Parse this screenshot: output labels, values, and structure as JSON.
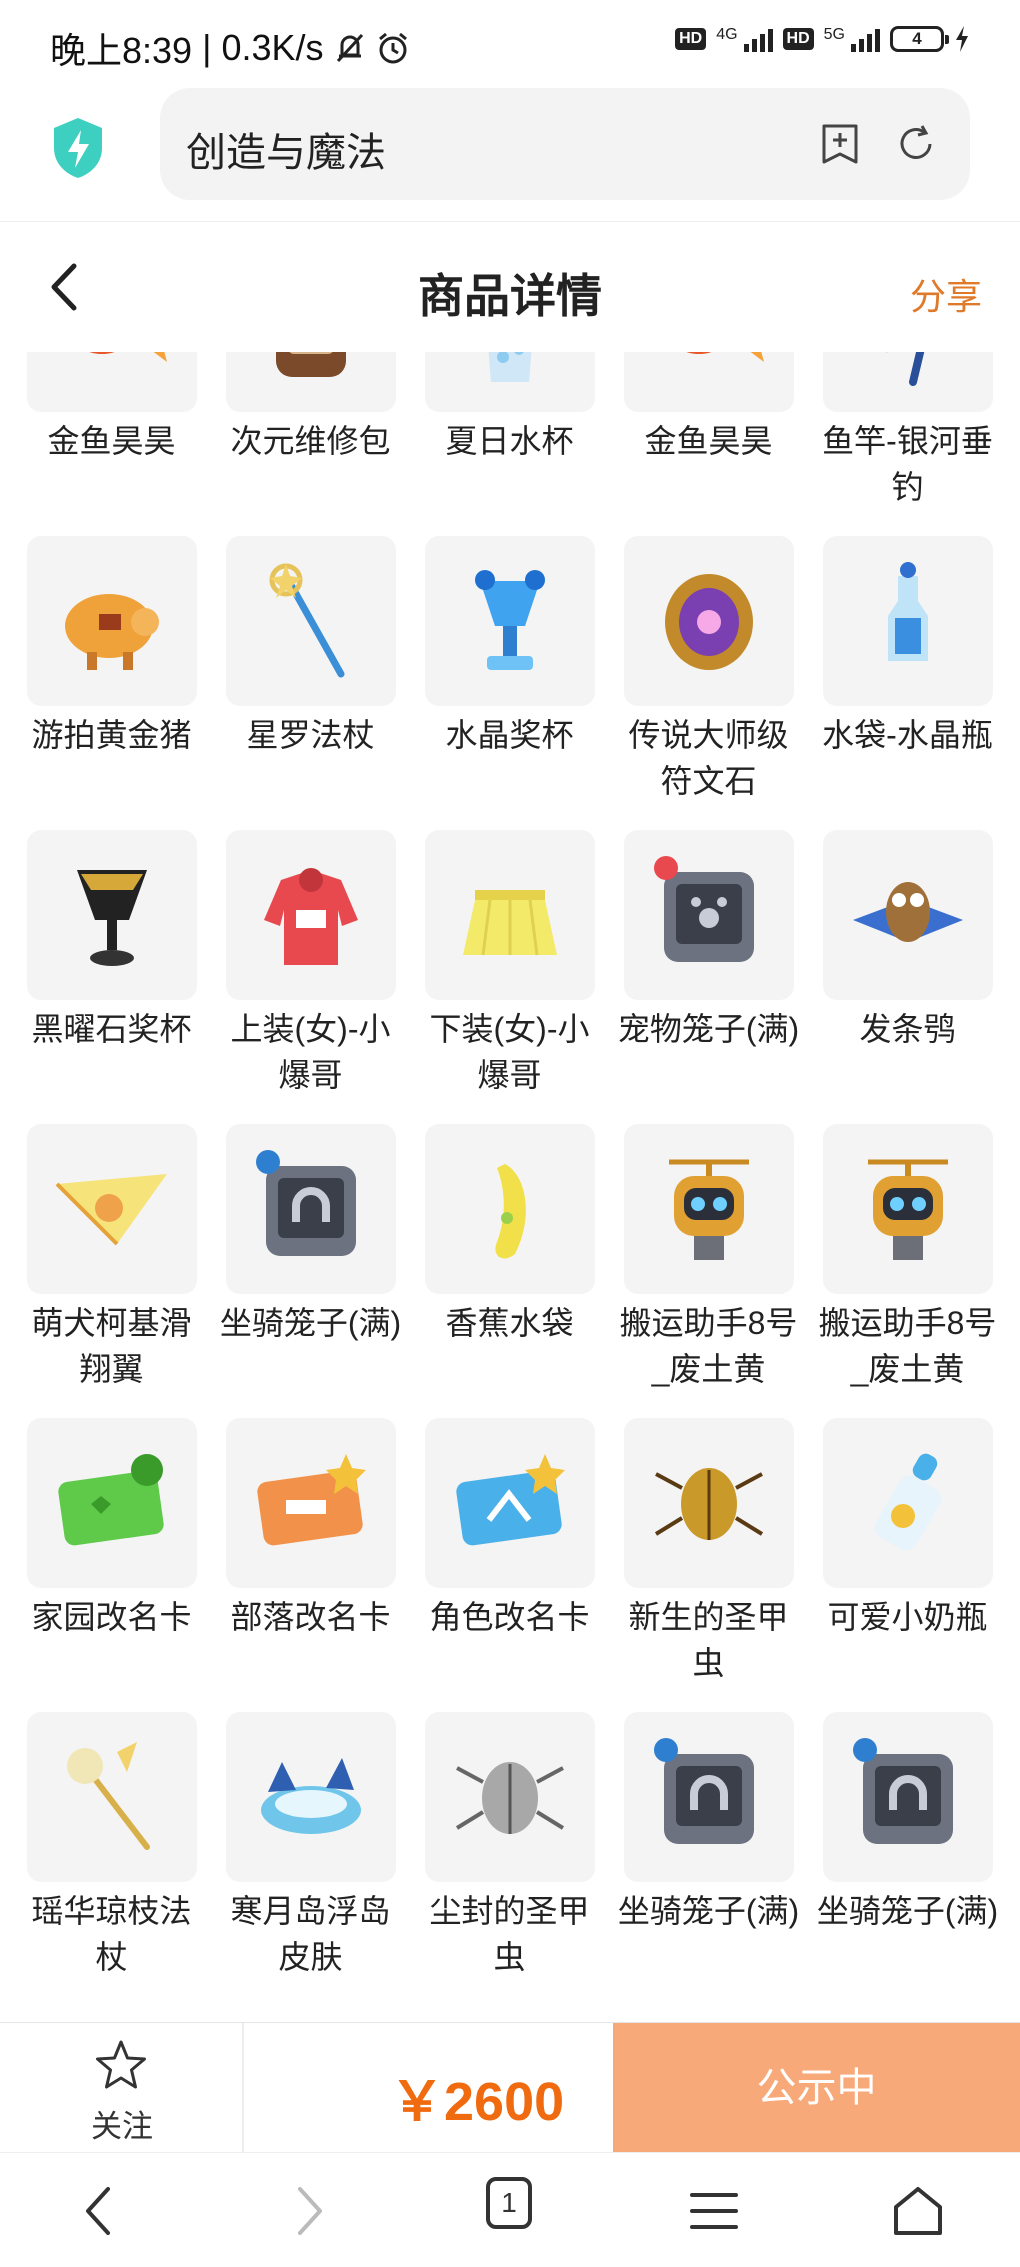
{
  "status": {
    "time": "晚上8:39",
    "speed": "0.3K/s",
    "net1": "4G",
    "net2": "5G",
    "badge": "HD",
    "battery": "4"
  },
  "browser": {
    "url_text": "创造与魔法"
  },
  "header": {
    "title": "商品详情",
    "share": "分享"
  },
  "items": [
    {
      "name": "金鱼昊昊",
      "icon": "goldfish-icon"
    },
    {
      "name": "次元维修包",
      "icon": "backpack-icon"
    },
    {
      "name": "夏日水杯",
      "icon": "cup-icon"
    },
    {
      "name": "金鱼昊昊",
      "icon": "goldfish-icon"
    },
    {
      "name": "鱼竿-银河垂钓",
      "icon": "fishing-rod-icon"
    },
    {
      "name": "游拍黄金猪",
      "icon": "golden-pig-icon"
    },
    {
      "name": "星罗法杖",
      "icon": "staff-icon"
    },
    {
      "name": "水晶奖杯",
      "icon": "crystal-trophy-icon"
    },
    {
      "name": "传说大师级符文石",
      "icon": "rune-stone-icon"
    },
    {
      "name": "水袋-水晶瓶",
      "icon": "crystal-bottle-icon"
    },
    {
      "name": "黑曜石奖杯",
      "icon": "obsidian-trophy-icon"
    },
    {
      "name": "上装(女)-小爆哥",
      "icon": "hoodie-icon"
    },
    {
      "name": "下装(女)-小爆哥",
      "icon": "skirt-icon"
    },
    {
      "name": "宠物笼子(满)",
      "icon": "pet-cage-icon"
    },
    {
      "name": "发条鸮",
      "icon": "owl-icon"
    },
    {
      "name": "萌犬柯基滑翔翼",
      "icon": "glider-icon"
    },
    {
      "name": "坐骑笼子(满)",
      "icon": "mount-cage-icon"
    },
    {
      "name": "香蕉水袋",
      "icon": "banana-icon"
    },
    {
      "name": "搬运助手8号_废土黄",
      "icon": "robot-icon"
    },
    {
      "name": "搬运助手8号_废土黄",
      "icon": "robot-icon"
    },
    {
      "name": "家园改名卡",
      "icon": "rename-card-green-icon"
    },
    {
      "name": "部落改名卡",
      "icon": "rename-card-orange-icon"
    },
    {
      "name": "角色改名卡",
      "icon": "rename-card-blue-icon"
    },
    {
      "name": "新生的圣甲虫",
      "icon": "scarab-gold-icon"
    },
    {
      "name": "可爱小奶瓶",
      "icon": "baby-bottle-icon"
    },
    {
      "name": "瑶华琼枝法杖",
      "icon": "jade-staff-icon"
    },
    {
      "name": "寒月岛浮岛皮肤",
      "icon": "floating-island-icon"
    },
    {
      "name": "尘封的圣甲虫",
      "icon": "scarab-gray-icon"
    },
    {
      "name": "坐骑笼子(满)",
      "icon": "mount-cage-icon"
    },
    {
      "name": "坐骑笼子(满)",
      "icon": "mount-cage-icon"
    }
  ],
  "action": {
    "follow_label": "关注",
    "price": "￥2600",
    "status_button": "公示中"
  },
  "navbar": {
    "tab_count": "1"
  }
}
